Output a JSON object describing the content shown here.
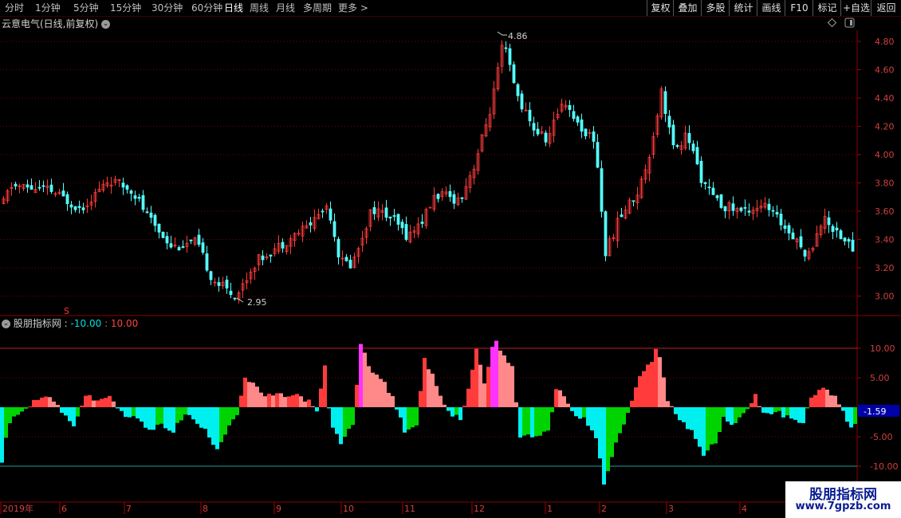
{
  "toolbar": {
    "periods": [
      "分时",
      "1分钟",
      "5分钟",
      "15分钟",
      "30分钟",
      "60分钟",
      "日线",
      "周线",
      "月线",
      "多周期",
      "更多 >"
    ],
    "active_period": "日线",
    "buttons": [
      "复权",
      "叠加",
      "多股",
      "统计",
      "画线",
      "F10",
      "标记",
      "+自选",
      "返回"
    ]
  },
  "price_panel": {
    "title": "云意电气(日线,前复权)",
    "high_label": "4.86",
    "low_label": "2.95",
    "y_ticks": [
      "4.80",
      "4.60",
      "4.40",
      "4.20",
      "4.00",
      "3.80",
      "3.60",
      "3.40",
      "3.20",
      "3.00"
    ]
  },
  "indicator_panel": {
    "name": "股朋指标网",
    "sep": ":",
    "low": "-10.00",
    "high": "10.00",
    "current_value": "-1.59",
    "y_ticks": [
      "10.00",
      "5.00",
      "-5.00",
      "-10.00"
    ]
  },
  "x_axis": {
    "labels": [
      "2019年",
      "6",
      "7",
      "8",
      "9",
      "10",
      "11",
      "12",
      "1",
      "2",
      "3",
      "4"
    ]
  },
  "watermark": {
    "line1": "股朋指标网",
    "line2": "www.7gpzb.com"
  },
  "colors": {
    "up": "#ff3b3b",
    "down": "#54ffff",
    "grid": "#7a0000",
    "pink": "#ff8888",
    "magenta": "#ff33ff",
    "green": "#00d400",
    "cyan": "#00f0f0"
  }
}
